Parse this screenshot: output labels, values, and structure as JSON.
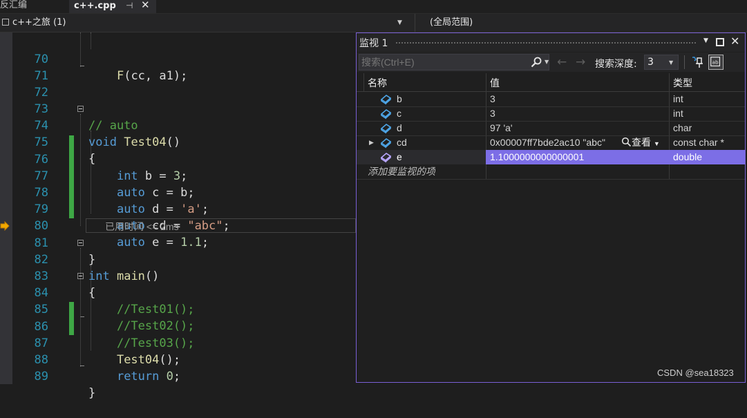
{
  "tabs": {
    "previous_label": "反汇编",
    "active_label": "c++.cpp",
    "pin_glyph": "⊣",
    "close_glyph": "✕"
  },
  "navbar": {
    "project": "c++之旅 (1)",
    "scope": "(全局范围)"
  },
  "editor": {
    "elapsed_hint": "已用时间 <= 2ms",
    "lines": [
      {
        "n": "70",
        "code": "        F(cc, a1);"
      },
      {
        "n": "71",
        "code": ""
      },
      {
        "n": "72",
        "code": ""
      },
      {
        "n": "73",
        "code": "// auto"
      },
      {
        "n": "74",
        "code": "void Test04()"
      },
      {
        "n": "75",
        "code": "{"
      },
      {
        "n": "76",
        "code": "    int b = 3;"
      },
      {
        "n": "77",
        "code": "    auto c = b;"
      },
      {
        "n": "78",
        "code": "    auto d = 'a';"
      },
      {
        "n": "79",
        "code": "    auto cd = \"abc\";"
      },
      {
        "n": "80",
        "code": "    auto e = 1.1;"
      },
      {
        "n": "81",
        "code": "}"
      },
      {
        "n": "82",
        "code": "int main()"
      },
      {
        "n": "83",
        "code": "{"
      },
      {
        "n": "84",
        "code": "    //Test01();"
      },
      {
        "n": "85",
        "code": "    //Test02();"
      },
      {
        "n": "86",
        "code": "    //Test03();"
      },
      {
        "n": "87",
        "code": "    Test04();"
      },
      {
        "n": "88",
        "code": "    return 0;"
      },
      {
        "n": "89",
        "code": "}"
      }
    ],
    "colors": {
      "keyword": "#569cd6",
      "function": "#dcdcaa",
      "string": "#d69d85",
      "comment": "#57a64a",
      "line_number": "#2b91af",
      "change_bar": "#3ea745"
    }
  },
  "watch": {
    "title": "监视 1",
    "search_placeholder": "搜索(Ctrl+E)",
    "depth_label": "搜索深度:",
    "depth_value": "3",
    "columns": {
      "name": "名称",
      "value": "值",
      "type": "类型"
    },
    "rows": [
      {
        "name": "b",
        "value": "3",
        "type": "int"
      },
      {
        "name": "c",
        "value": "3",
        "type": "int"
      },
      {
        "name": "d",
        "value": "97 'a'",
        "type": "char"
      },
      {
        "name": "cd",
        "value": "0x00007ff7bde2ac10 \"abc\"",
        "type": "const char *",
        "view_label": "查看"
      },
      {
        "name": "e",
        "value": "1.1000000000000001",
        "type": "double"
      }
    ],
    "add_placeholder": "添加要监视的项",
    "selection_color": "#7c6ee6",
    "border_color": "#7a5fd6"
  },
  "watermark": "CSDN @sea18323"
}
